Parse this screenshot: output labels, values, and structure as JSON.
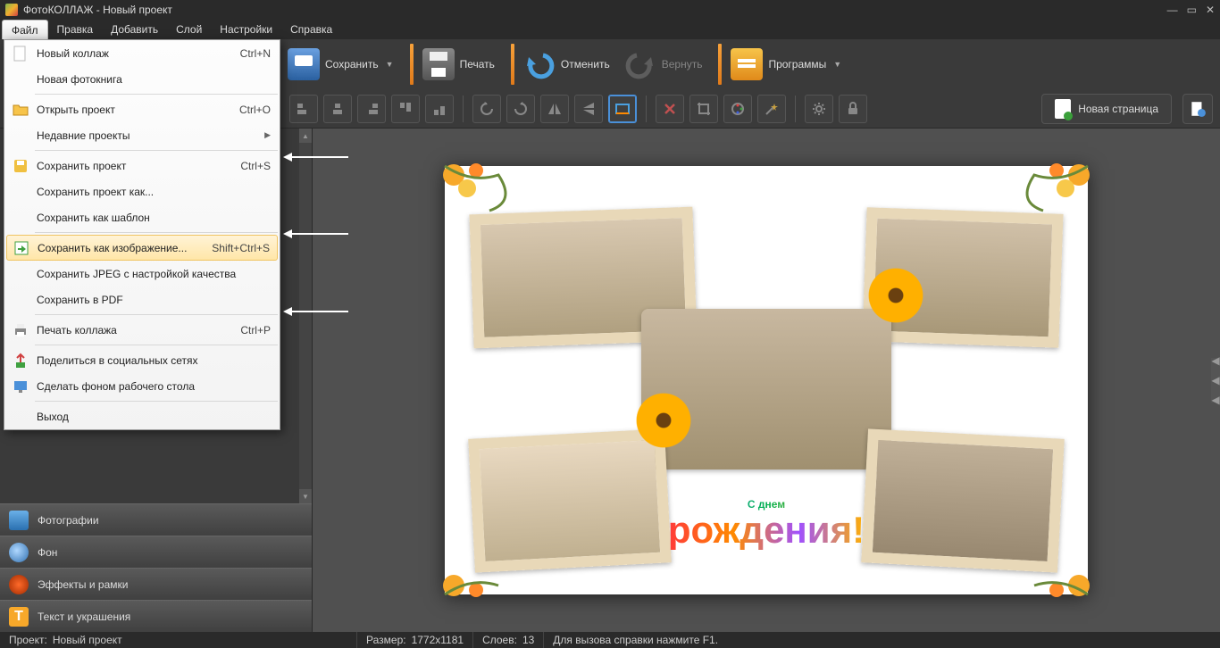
{
  "app": {
    "title": "ФотоКОЛЛАЖ - Новый проект"
  },
  "menubar": {
    "items": [
      "Файл",
      "Правка",
      "Добавить",
      "Слой",
      "Настройки",
      "Справка"
    ],
    "active_index": 0
  },
  "toolbar": {
    "save": "Сохранить",
    "print": "Печать",
    "undo": "Отменить",
    "redo": "Вернуть",
    "programs": "Программы"
  },
  "toolbar2": {
    "new_page": "Новая страница"
  },
  "file_menu": {
    "new_collage": {
      "label": "Новый коллаж",
      "shortcut": "Ctrl+N"
    },
    "new_photobook": {
      "label": "Новая фотокнига"
    },
    "open_project": {
      "label": "Открыть проект",
      "shortcut": "Ctrl+O"
    },
    "recent": {
      "label": "Недавние проекты"
    },
    "save_project": {
      "label": "Сохранить проект",
      "shortcut": "Ctrl+S"
    },
    "save_project_as": {
      "label": "Сохранить проект как..."
    },
    "save_template": {
      "label": "Сохранить как шаблон"
    },
    "save_image": {
      "label": "Сохранить как изображение...",
      "shortcut": "Shift+Ctrl+S"
    },
    "save_jpeg": {
      "label": "Сохранить JPEG с настройкой качества"
    },
    "save_pdf": {
      "label": "Сохранить в PDF"
    },
    "print": {
      "label": "Печать коллажа",
      "shortcut": "Ctrl+P"
    },
    "share": {
      "label": "Поделиться в социальных сетях"
    },
    "wallpaper": {
      "label": "Сделать фоном рабочего стола"
    },
    "exit": {
      "label": "Выход"
    }
  },
  "accordion": {
    "photos": "Фотографии",
    "background": "Фон",
    "effects": "Эффекты и рамки",
    "text": "Текст и украшения"
  },
  "canvas": {
    "greeting_line1": "С днем",
    "greeting_line2": "рождения!"
  },
  "status": {
    "project_label": "Проект:",
    "project_value": "Новый проект",
    "size_label": "Размер:",
    "size_value": "1772x1181",
    "layers_label": "Слоев:",
    "layers_value": "13",
    "help": "Для вызова справки нажмите F1."
  }
}
